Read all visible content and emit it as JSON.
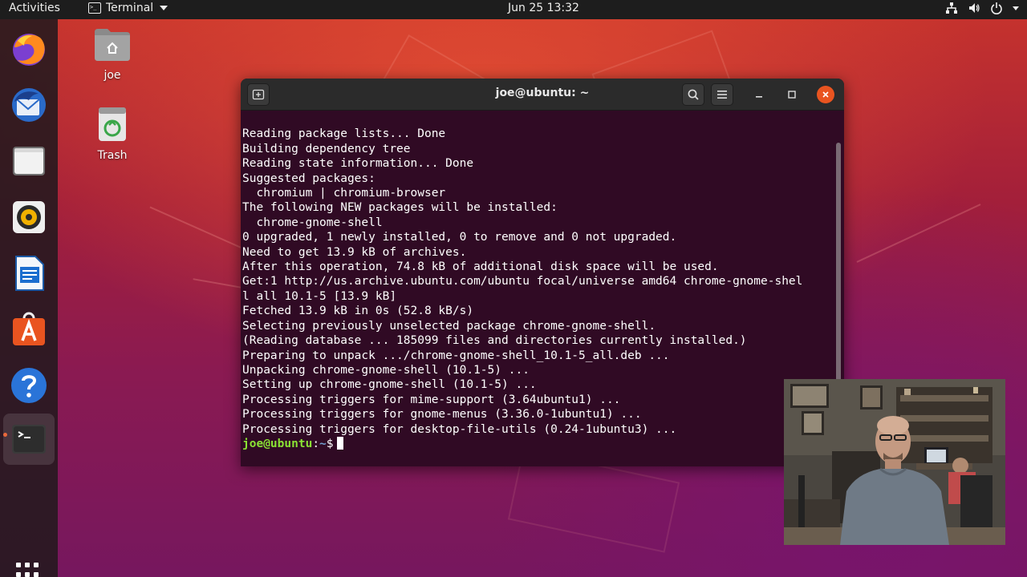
{
  "topbar": {
    "activities": "Activities",
    "app_name": "Terminal",
    "clock": "Jun 25  13:32"
  },
  "dock": {
    "items": [
      "Firefox",
      "Thunderbird Mail",
      "Files",
      "Rhythmbox",
      "LibreOffice Writer",
      "Ubuntu Software",
      "Help",
      "Terminal"
    ],
    "show_apps": "Show Applications"
  },
  "desktop": {
    "home_label": "joe",
    "trash_label": "Trash"
  },
  "terminal": {
    "title": "joe@ubuntu: ~",
    "lines": [
      "Reading package lists... Done",
      "Building dependency tree",
      "Reading state information... Done",
      "Suggested packages:",
      "  chromium | chromium-browser",
      "The following NEW packages will be installed:",
      "  chrome-gnome-shell",
      "0 upgraded, 1 newly installed, 0 to remove and 0 not upgraded.",
      "Need to get 13.9 kB of archives.",
      "After this operation, 74.8 kB of additional disk space will be used.",
      "Get:1 http://us.archive.ubuntu.com/ubuntu focal/universe amd64 chrome-gnome-shel",
      "l all 10.1-5 [13.9 kB]",
      "Fetched 13.9 kB in 0s (52.8 kB/s)",
      "Selecting previously unselected package chrome-gnome-shell.",
      "(Reading database ... 185099 files and directories currently installed.)",
      "Preparing to unpack .../chrome-gnome-shell_10.1-5_all.deb ...",
      "Unpacking chrome-gnome-shell (10.1-5) ...",
      "Setting up chrome-gnome-shell (10.1-5) ...",
      "Processing triggers for mime-support (3.64ubuntu1) ...",
      "Processing triggers for gnome-menus (3.36.0-1ubuntu1) ...",
      "Processing triggers for desktop-file-utils (0.24-1ubuntu3) ..."
    ],
    "prompt_user": "joe@ubuntu",
    "prompt_sep": ":",
    "prompt_path": "~",
    "prompt_symbol": "$"
  },
  "colors": {
    "terminal_bg": "#300a24",
    "prompt_user": "#8ae234",
    "prompt_path": "#729fcf",
    "accent": "#e95420"
  }
}
